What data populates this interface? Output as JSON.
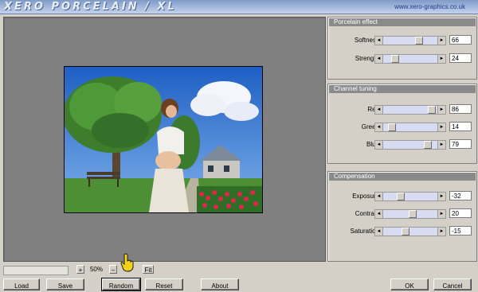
{
  "app": {
    "logo_text": "XERO PORCELAIN / XL",
    "website": "www.xero-graphics.co.uk"
  },
  "panels": [
    {
      "title": "Porcelain effect",
      "sliders": [
        {
          "label": "Softness",
          "value": "66",
          "level_pct": 66
        },
        {
          "label": "Strength",
          "value": "24",
          "level_pct": 24
        }
      ]
    },
    {
      "title": "Channel tuning",
      "sliders": [
        {
          "label": "Red",
          "value": "86",
          "level_pct": 86
        },
        {
          "label": "Green",
          "value": "14",
          "level_pct": 14
        },
        {
          "label": "Blue",
          "value": "79",
          "level_pct": 79
        }
      ]
    },
    {
      "title": "Compensation",
      "sliders": [
        {
          "label": "Exposure",
          "value": "-32",
          "level_pct": 34
        },
        {
          "label": "Contrast",
          "value": "20",
          "level_pct": 60
        },
        {
          "label": "Saturation",
          "value": "-15",
          "level_pct": 42
        }
      ]
    }
  ],
  "zoom": {
    "plus_label": "+",
    "value": "50%",
    "minus_label": "–",
    "fit_label": "Fit"
  },
  "buttons": {
    "load": "Load",
    "save": "Save",
    "random": "Random",
    "reset": "Reset",
    "about": "About",
    "ok": "OK",
    "cancel": "Cancel"
  },
  "colors": {
    "slider_track": "#d8dcf2",
    "panel_header": "#8a8a8a",
    "preview_bg": "#808080"
  }
}
